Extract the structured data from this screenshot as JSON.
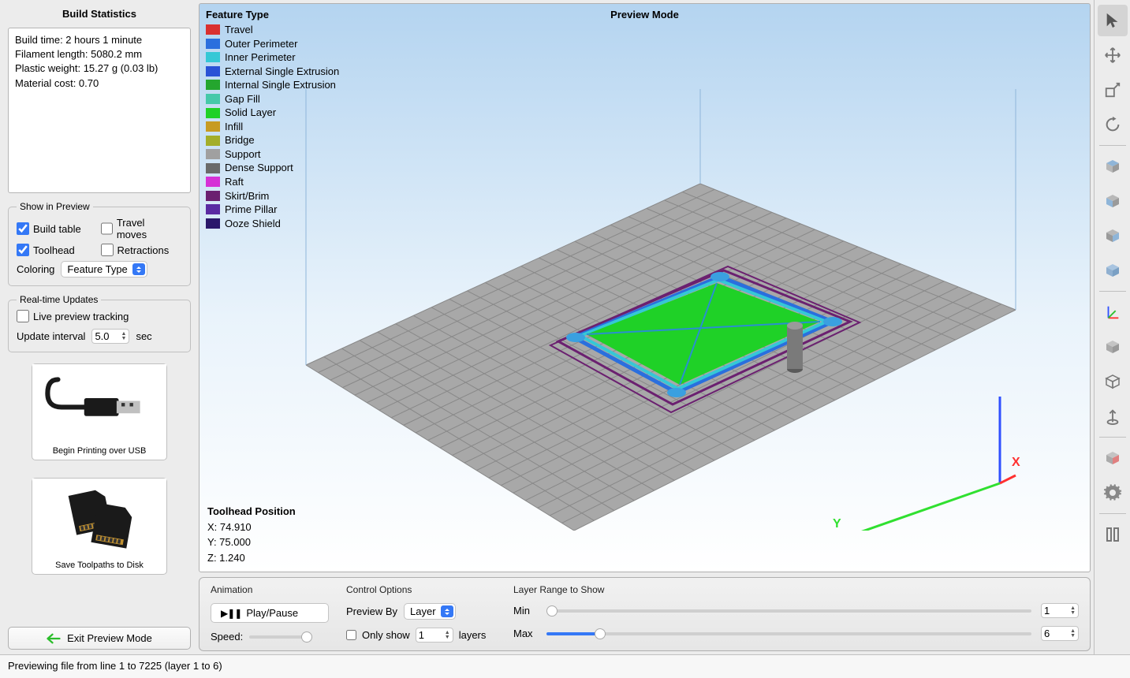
{
  "sidebar": {
    "title": "Build Statistics",
    "stats": {
      "line1": "Build time: 2 hours 1 minute",
      "line2": "Filament length: 5080.2 mm",
      "line3": "Plastic weight: 15.27 g (0.03 lb)",
      "line4": "Material cost: 0.70"
    },
    "show_in_preview": {
      "legend": "Show in Preview",
      "build_table": "Build table",
      "travel_moves": "Travel moves",
      "toolhead": "Toolhead",
      "retractions": "Retractions",
      "coloring_label": "Coloring",
      "coloring_value": "Feature Type"
    },
    "realtime": {
      "legend": "Real-time Updates",
      "live_preview": "Live preview tracking",
      "interval_label": "Update interval",
      "interval_value": "5.0",
      "sec_label": "sec"
    },
    "usb_card": "Begin Printing over USB",
    "sd_card": "Save Toolpaths to Disk",
    "exit_btn": "Exit Preview Mode"
  },
  "viewport": {
    "legend_title": "Feature Type",
    "preview_mode": "Preview Mode",
    "legend_items": [
      {
        "label": "Travel",
        "color": "#d93030"
      },
      {
        "label": "Outer Perimeter",
        "color": "#2a6fde"
      },
      {
        "label": "Inner Perimeter",
        "color": "#35c8d6"
      },
      {
        "label": "External Single Extrusion",
        "color": "#2952d6"
      },
      {
        "label": "Internal Single Extrusion",
        "color": "#24a62e"
      },
      {
        "label": "Gap Fill",
        "color": "#45c9a9"
      },
      {
        "label": "Solid Layer",
        "color": "#1fd127"
      },
      {
        "label": "Infill",
        "color": "#c79b22"
      },
      {
        "label": "Bridge",
        "color": "#a3ae2a"
      },
      {
        "label": "Support",
        "color": "#a0a0a0"
      },
      {
        "label": "Dense Support",
        "color": "#6a6a6a"
      },
      {
        "label": "Raft",
        "color": "#d631d6"
      },
      {
        "label": "Skirt/Brim",
        "color": "#6b2070"
      },
      {
        "label": "Prime Pillar",
        "color": "#5a2aa3"
      },
      {
        "label": "Ooze Shield",
        "color": "#2a186b"
      }
    ],
    "toolhead": {
      "title": "Toolhead Position",
      "x": "X: 74.910",
      "y": "Y: 75.000",
      "z": "Z: 1.240"
    }
  },
  "bottom": {
    "animation": {
      "title": "Animation",
      "play_pause": "Play/Pause",
      "speed_label": "Speed:"
    },
    "control": {
      "title": "Control Options",
      "preview_by": "Preview By",
      "preview_by_value": "Layer",
      "only_show": "Only show",
      "only_show_value": "1",
      "layers_label": "layers"
    },
    "layer_range": {
      "title": "Layer Range to Show",
      "min_label": "Min",
      "max_label": "Max",
      "min_value": "1",
      "max_value": "6"
    }
  },
  "statusbar": "Previewing file from line 1 to 7225 (layer 1 to 6)"
}
